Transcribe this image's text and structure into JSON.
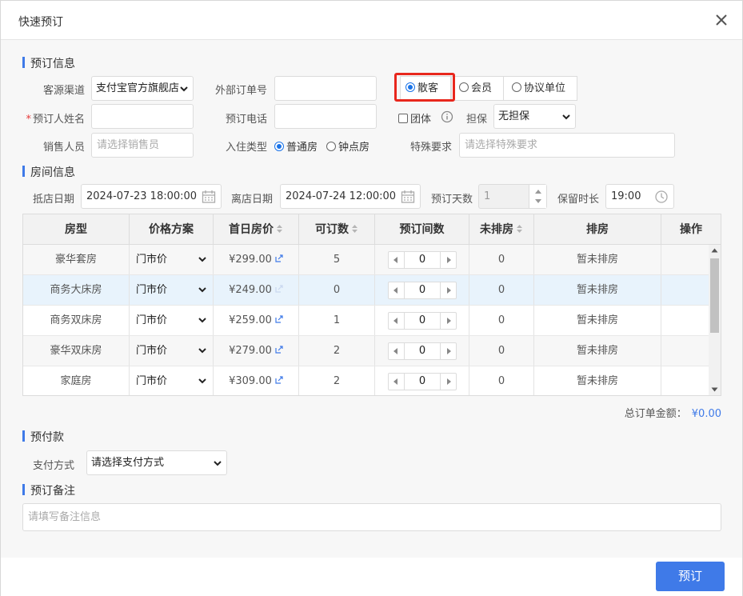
{
  "dialog": {
    "title": "快速预订"
  },
  "booking_info": {
    "section_title": "预订信息",
    "source_channel": {
      "label": "客源渠道",
      "value": "支付宝官方旗舰店"
    },
    "external_order": {
      "label": "外部订单号",
      "value": ""
    },
    "guest_type": {
      "options": [
        "散客",
        "会员",
        "协议单位"
      ],
      "selected": "散客"
    },
    "booker_name": {
      "label": "预订人姓名",
      "value": ""
    },
    "booking_phone": {
      "label": "预订电话",
      "value": ""
    },
    "group": {
      "label": "团体"
    },
    "guarantee": {
      "label": "担保",
      "value": "无担保"
    },
    "sales_person": {
      "label": "销售人员",
      "placeholder": "请选择销售员"
    },
    "checkin_type": {
      "label": "入住类型",
      "options": [
        "普通房",
        "钟点房"
      ],
      "selected": "普通房"
    },
    "special_request": {
      "label": "特殊要求",
      "placeholder": "请选择特殊要求"
    }
  },
  "room_info": {
    "section_title": "房间信息",
    "arrival": {
      "label": "抵店日期",
      "value": "2024-07-23 18:00:00"
    },
    "departure": {
      "label": "离店日期",
      "value": "2024-07-24 12:00:00"
    },
    "nights": {
      "label": "预订天数",
      "value": "1"
    },
    "hold_time": {
      "label": "保留时长",
      "value": "19:00"
    },
    "columns": [
      "房型",
      "价格方案",
      "首日房价",
      "可订数",
      "预订间数",
      "未排房",
      "排房",
      "操作"
    ],
    "rows": [
      {
        "room_type": "豪华套房",
        "plan": "门市价",
        "price": "¥299.00",
        "available": "5",
        "qty": "0",
        "unassigned": "0",
        "assign": "暂未排房"
      },
      {
        "room_type": "商务大床房",
        "plan": "门市价",
        "price": "¥249.00",
        "available": "0",
        "qty": "0",
        "unassigned": "0",
        "assign": "暂未排房"
      },
      {
        "room_type": "商务双床房",
        "plan": "门市价",
        "price": "¥259.00",
        "available": "1",
        "qty": "0",
        "unassigned": "0",
        "assign": "暂未排房"
      },
      {
        "room_type": "豪华双床房",
        "plan": "门市价",
        "price": "¥279.00",
        "available": "2",
        "qty": "0",
        "unassigned": "0",
        "assign": "暂未排房"
      },
      {
        "room_type": "家庭房",
        "plan": "门市价",
        "price": "¥309.00",
        "available": "2",
        "qty": "0",
        "unassigned": "0",
        "assign": "暂未排房"
      }
    ],
    "total": {
      "label": "总订单金额：",
      "value": "¥0.00"
    }
  },
  "prepay": {
    "section_title": "预付款",
    "method": {
      "label": "支付方式",
      "value": "请选择支付方式"
    }
  },
  "remarks": {
    "section_title": "预订备注",
    "placeholder": "请填写备注信息"
  },
  "footer": {
    "submit_label": "预订"
  },
  "colors": {
    "accent": "#3f7ae8",
    "highlight": "#e8271d",
    "row_highlight": "#e8f3fc"
  },
  "icons": [
    "close-icon",
    "info-icon",
    "calendar-icon",
    "clock-icon",
    "sort-icon",
    "edit-icon",
    "chevron-down-icon"
  ]
}
